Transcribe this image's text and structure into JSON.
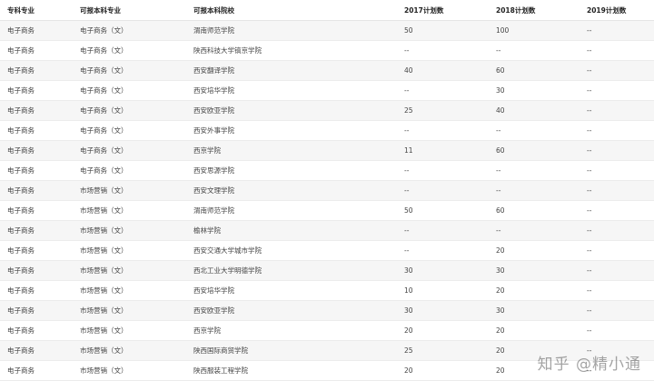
{
  "table": {
    "headers": [
      "专科专业",
      "可报本科专业",
      "可报本科院校",
      "2017计划数",
      "2018计划数",
      "2019计划数"
    ],
    "rows": [
      [
        "电子商务",
        "电子商务（文）",
        "渭南师范学院",
        "50",
        "100",
        "--"
      ],
      [
        "电子商务",
        "电子商务（文）",
        "陕西科技大学镐京学院",
        "--",
        "--",
        "--"
      ],
      [
        "电子商务",
        "电子商务（文）",
        "西安翻译学院",
        "40",
        "60",
        "--"
      ],
      [
        "电子商务",
        "电子商务（文）",
        "西安培华学院",
        "--",
        "30",
        "--"
      ],
      [
        "电子商务",
        "电子商务（文）",
        "西安欧亚学院",
        "25",
        "40",
        "--"
      ],
      [
        "电子商务",
        "电子商务（文）",
        "西安外事学院",
        "--",
        "--",
        "--"
      ],
      [
        "电子商务",
        "电子商务（文）",
        "西京学院",
        "11",
        "60",
        "--"
      ],
      [
        "电子商务",
        "电子商务（文）",
        "西安思源学院",
        "--",
        "--",
        "--"
      ],
      [
        "电子商务",
        "市场营销（文）",
        "西安文理学院",
        "--",
        "--",
        "--"
      ],
      [
        "电子商务",
        "市场营销（文）",
        "渭南师范学院",
        "50",
        "60",
        "--"
      ],
      [
        "电子商务",
        "市场营销（文）",
        "榆林学院",
        "--",
        "--",
        "--"
      ],
      [
        "电子商务",
        "市场营销（文）",
        "西安交通大学城市学院",
        "--",
        "20",
        "--"
      ],
      [
        "电子商务",
        "市场营销（文）",
        "西北工业大学明德学院",
        "30",
        "30",
        "--"
      ],
      [
        "电子商务",
        "市场营销（文）",
        "西安培华学院",
        "10",
        "20",
        "--"
      ],
      [
        "电子商务",
        "市场营销（文）",
        "西安欧亚学院",
        "30",
        "30",
        "--"
      ],
      [
        "电子商务",
        "市场营销（文）",
        "西京学院",
        "20",
        "20",
        "--"
      ],
      [
        "电子商务",
        "市场营销（文）",
        "陕西国际商贸学院",
        "25",
        "20",
        "--"
      ],
      [
        "电子商务",
        "市场营销（文）",
        "陕西服装工程学院",
        "20",
        "20",
        "--"
      ]
    ]
  },
  "watermark": "知乎 @精小通"
}
